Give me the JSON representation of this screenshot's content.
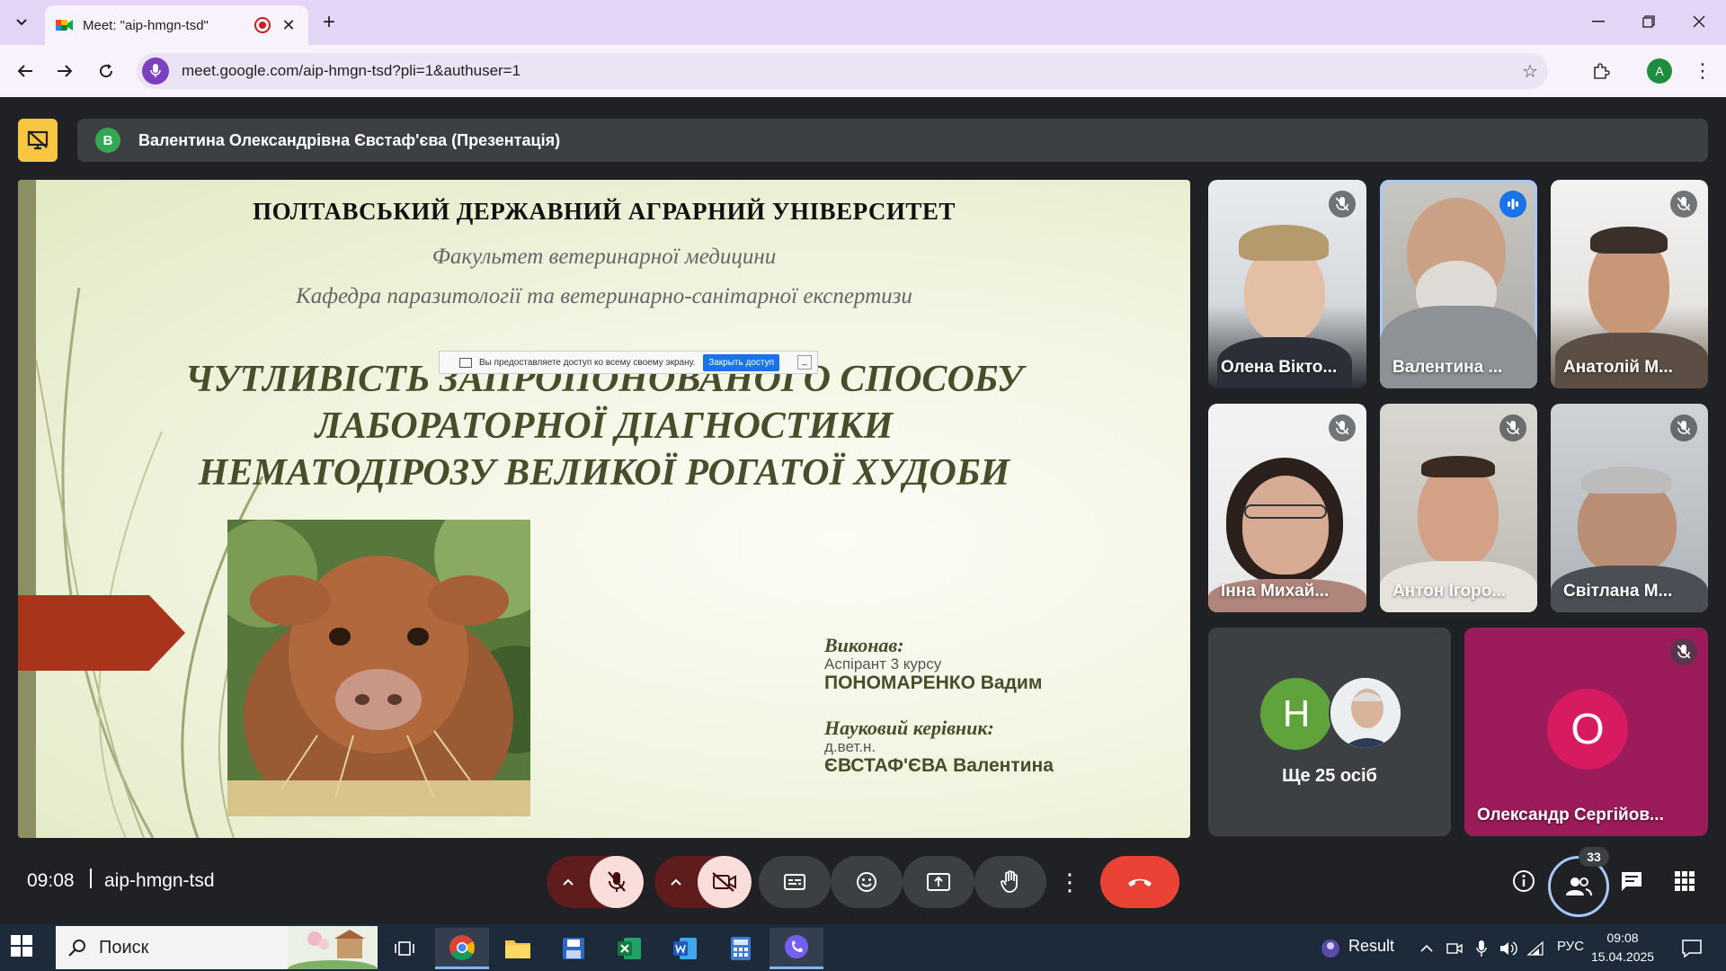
{
  "browser": {
    "tab_title": "Meet: \"aip-hmgn-tsd\"",
    "url": "meet.google.com/aip-hmgn-tsd?pli=1&authuser=1",
    "profile_initial": "A"
  },
  "meet": {
    "presenter_initial": "В",
    "presenter_banner": "Валентина Олександрівна Євстаф'єва (Презентація)",
    "slide": {
      "university": "ПОЛТАВСЬКИЙ ДЕРЖАВНИЙ АГРАРНИЙ УНІВЕРСИТЕТ",
      "faculty": "Факультет ветеринарної медицини",
      "department": "Кафедра паразитології та ветеринарно-санітарної експертизи",
      "title_lines": [
        "ЧУТЛИВІСТЬ ЗАПРОПОНОВАНОГО СПОСОБУ",
        "ЛАБОРАТОРНОЇ ДІАГНОСТИКИ",
        "НЕМАТОДІРОЗУ ВЕЛИКОЇ РОГАТОЇ ХУДОБИ"
      ],
      "performed_label": "Виконав:",
      "performed_role": "Аспірант 3 курсу",
      "performed_name": "ПОНОМАРЕНКО Вадим",
      "advisor_label": "Науковий керівник:",
      "advisor_degree": "д.вет.н.",
      "advisor_name": "ЄВСТАФ'ЄВА Валентина"
    },
    "share_notice": {
      "text": "Вы предоставляете доступ ко всему своему экрану.",
      "stop_button": "Закрыть доступ"
    },
    "participants": [
      {
        "name": "Олена Вікто...",
        "muted": true
      },
      {
        "name": "Валентина ...",
        "muted": false,
        "speaking": true
      },
      {
        "name": "Анатолій М...",
        "muted": true
      },
      {
        "name": "Інна Михай...",
        "muted": true
      },
      {
        "name": "Антон Ігоро...",
        "muted": true
      },
      {
        "name": "Світлана М...",
        "muted": true
      }
    ],
    "others": {
      "initial": "Н",
      "label": "Ще 25 осіб"
    },
    "last_tile": {
      "initial": "О",
      "name": "Олександр Сергійов..."
    },
    "time": "09:08",
    "meeting_code": "aip-hmgn-tsd",
    "participant_count": "33"
  },
  "taskbar": {
    "search_placeholder": "Поиск",
    "tray_app": "Result",
    "language": "РУС",
    "clock_time": "09:08",
    "clock_date": "15.04.2025"
  }
}
